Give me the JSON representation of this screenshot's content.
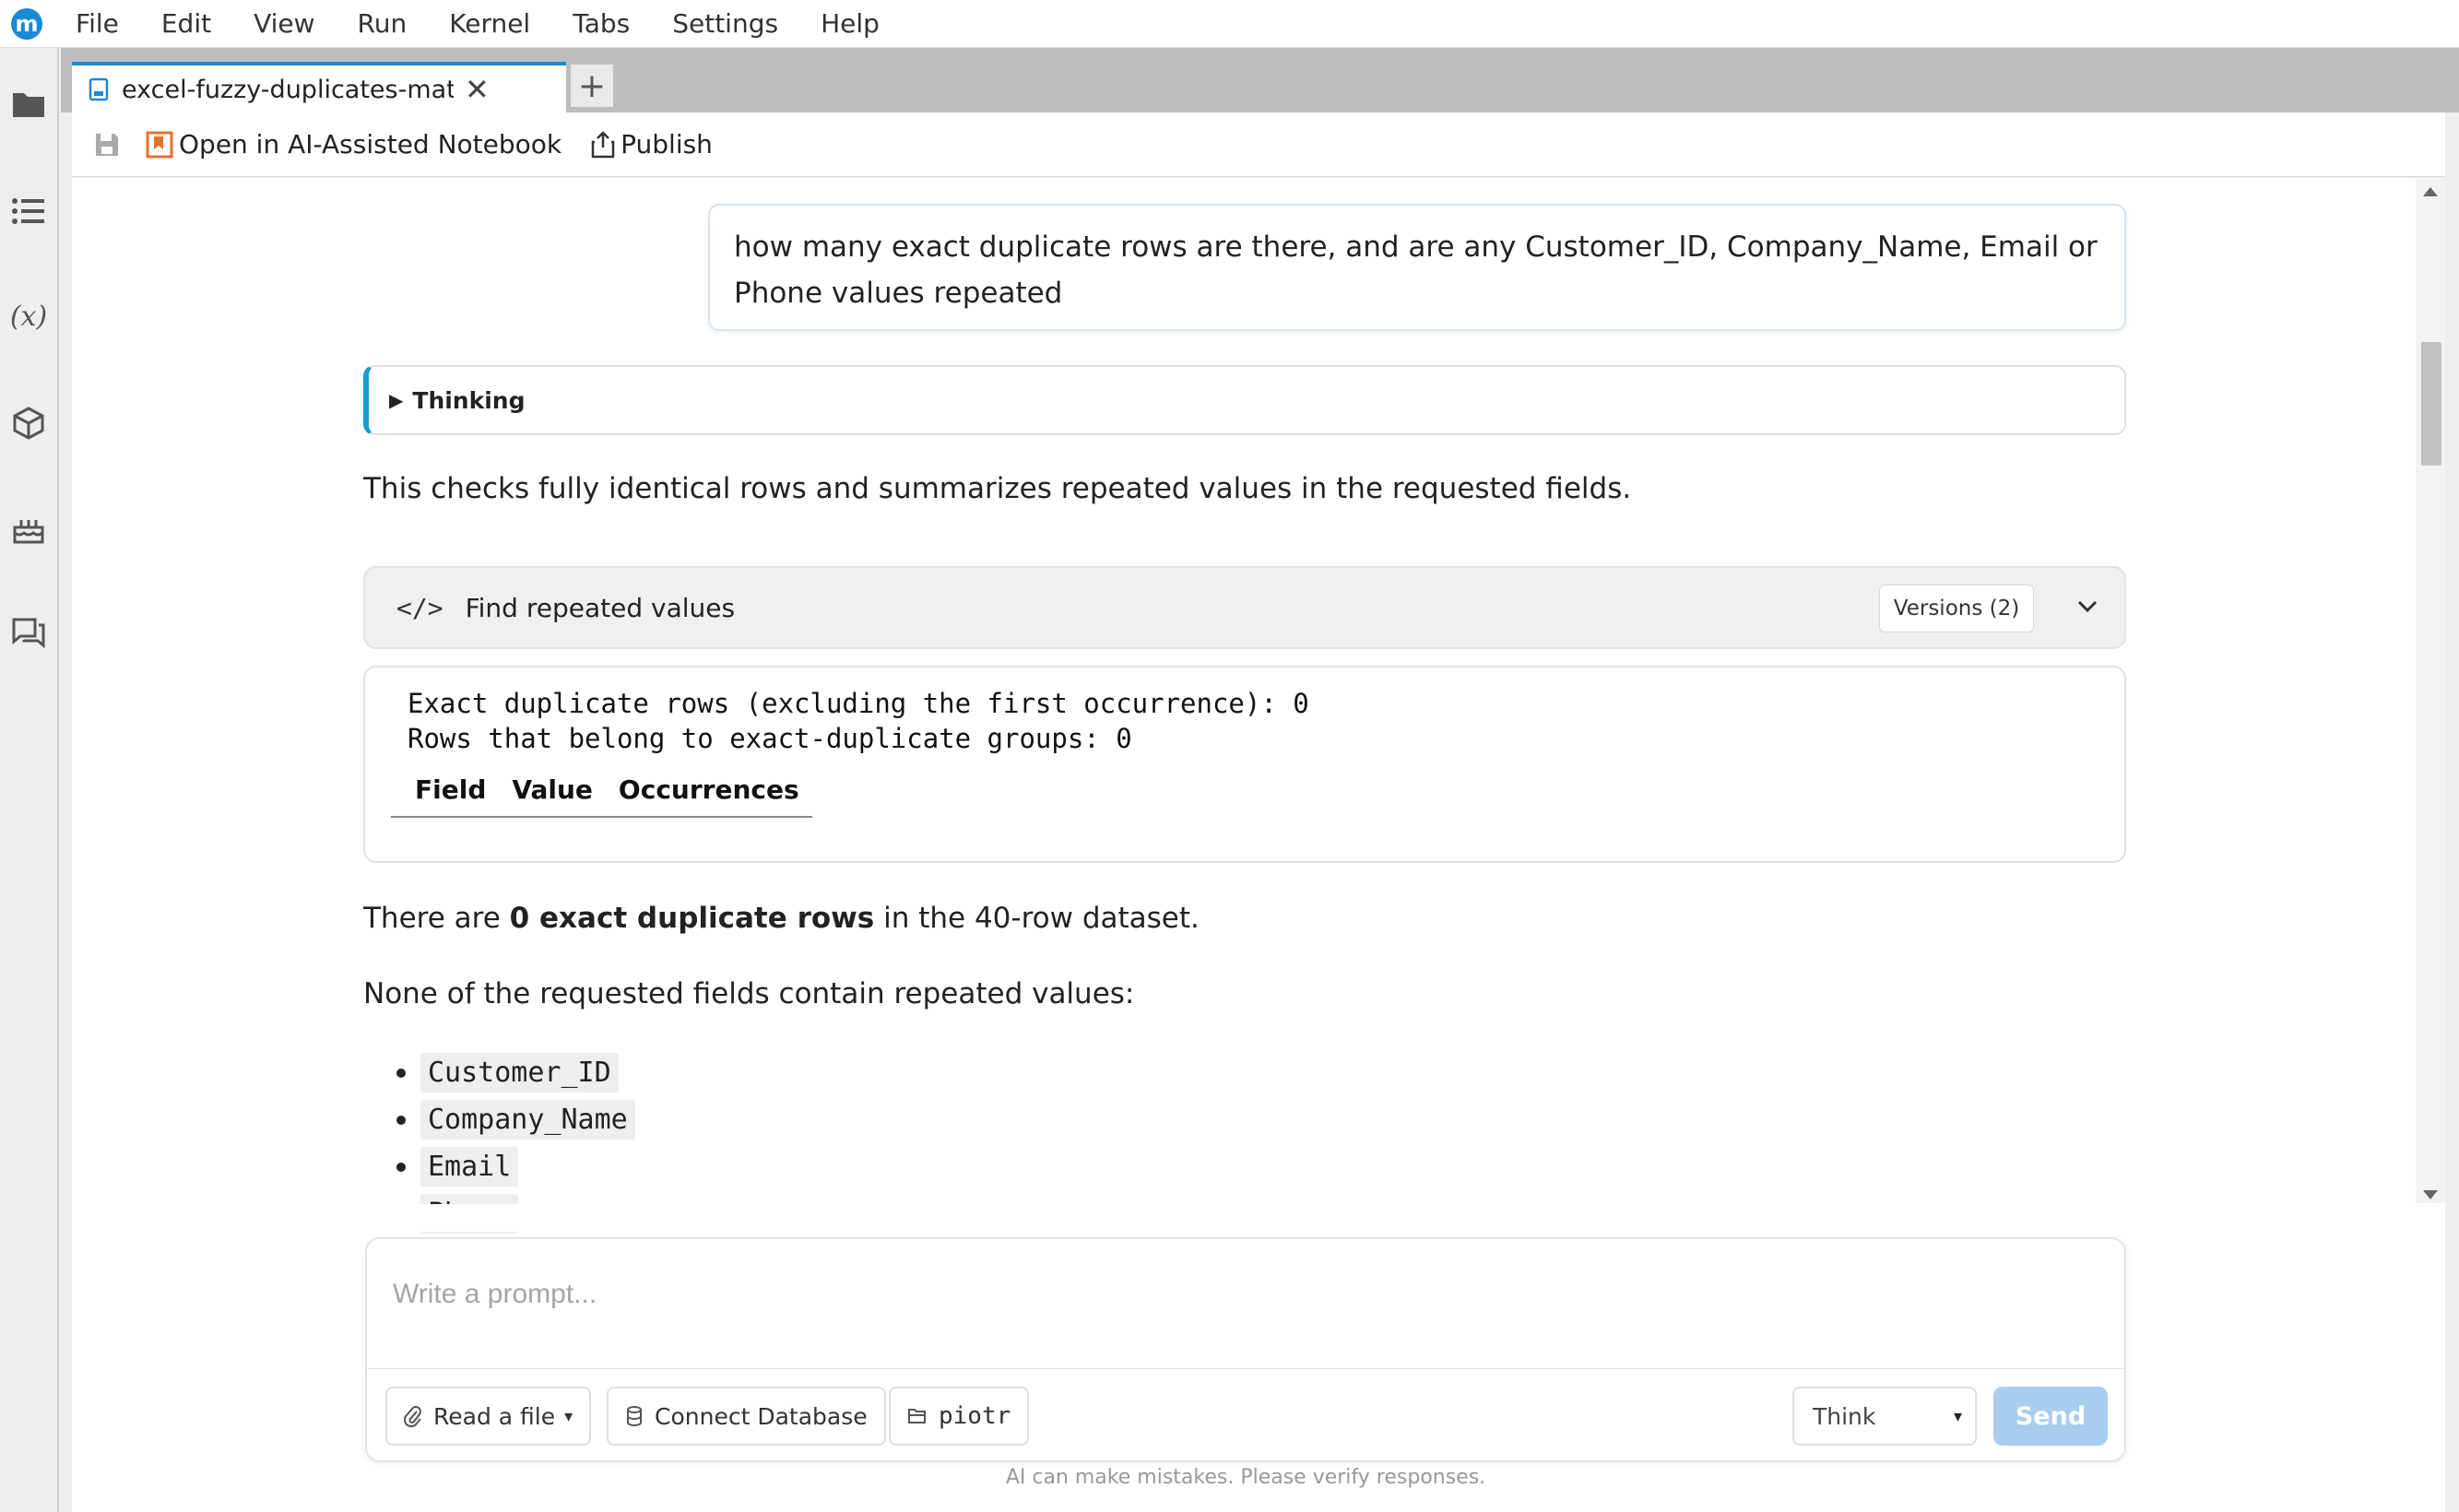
{
  "menu": {
    "items": [
      "File",
      "Edit",
      "View",
      "Run",
      "Kernel",
      "Tabs",
      "Settings",
      "Help"
    ]
  },
  "tab": {
    "title": "excel-fuzzy-duplicates-matcl",
    "add_label": "+"
  },
  "toolbar": {
    "open_ai_label": "Open in AI-Assisted Notebook",
    "publish_label": "Publish"
  },
  "chat": {
    "user_message": "how many exact duplicate rows are there, and are any Customer_ID, Company_Name, Email or Phone values repeated",
    "thinking_label": "Thinking",
    "intro": "This checks fully identical rows and summarizes repeated values in the requested fields.",
    "code_cell": {
      "icon": "</>",
      "title": "Find repeated values",
      "versions_label": "Versions (2)"
    },
    "output": {
      "line1": "Exact duplicate rows (excluding the first occurrence): 0",
      "line2": "Rows that belong to exact-duplicate groups: 0",
      "table_headers": [
        "Field",
        "Value",
        "Occurrences"
      ]
    },
    "answer": {
      "prefix": "There are ",
      "bold": "0 exact duplicate rows",
      "suffix": " in the 40-row dataset.",
      "line2": "None of the requested fields contain repeated values:",
      "fields": [
        "Customer_ID",
        "Company_Name",
        "Email",
        "Phone"
      ]
    }
  },
  "prompt": {
    "placeholder": "Write a prompt...",
    "read_file_label": "Read a file",
    "connect_db_label": "Connect Database",
    "folder_label": "piotr",
    "mode_label": "Think",
    "send_label": "Send",
    "disclaimer": "AI can make mistakes. Please verify responses."
  },
  "colors": {
    "accent": "#1a8ad4",
    "send_disabled": "#a8cdef",
    "thinking_bar": "#1a9bd4",
    "publish_icon_orange": "#e8702a"
  }
}
